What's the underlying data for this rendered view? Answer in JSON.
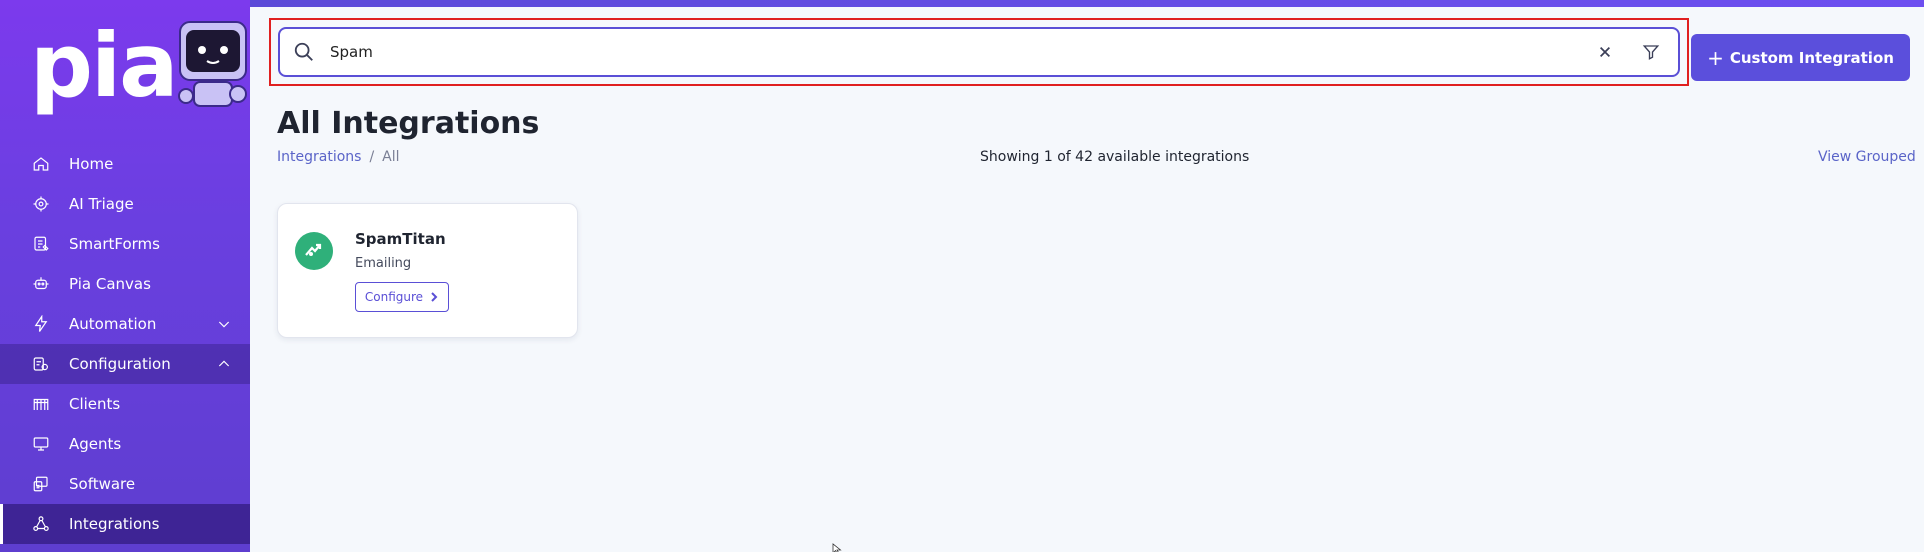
{
  "brand": {
    "logo_text": "pia"
  },
  "sidebar": {
    "items": [
      {
        "label": "Home",
        "icon": "home-icon"
      },
      {
        "label": "AI Triage",
        "icon": "ai-chip-icon"
      },
      {
        "label": "SmartForms",
        "icon": "form-icon"
      },
      {
        "label": "Pia Canvas",
        "icon": "canvas-icon"
      },
      {
        "label": "Automation",
        "icon": "bolt-icon",
        "expand": "chevron-down"
      },
      {
        "label": "Configuration",
        "icon": "config-icon",
        "expand": "chevron-up"
      },
      {
        "label": "Clients",
        "icon": "clients-icon"
      },
      {
        "label": "Agents",
        "icon": "monitor-icon"
      },
      {
        "label": "Software",
        "icon": "software-icon"
      },
      {
        "label": "Integrations",
        "icon": "integrations-icon"
      }
    ]
  },
  "search": {
    "value": "Spam",
    "placeholder": ""
  },
  "header": {
    "custom_button": "Custom Integration"
  },
  "page": {
    "title": "All Integrations",
    "breadcrumb": [
      "Integrations",
      "All"
    ],
    "showing": "Showing 1 of 42 available integrations",
    "view_grouped": "View Grouped"
  },
  "integrations": [
    {
      "name": "SpamTitan",
      "category": "Emailing",
      "action": "Configure",
      "icon_color": "#2fb07a"
    }
  ],
  "colors": {
    "sidebar": "#6a3fe0",
    "accent": "#5b4fdc",
    "highlight_border": "#e02020",
    "link": "#5a64c8"
  }
}
